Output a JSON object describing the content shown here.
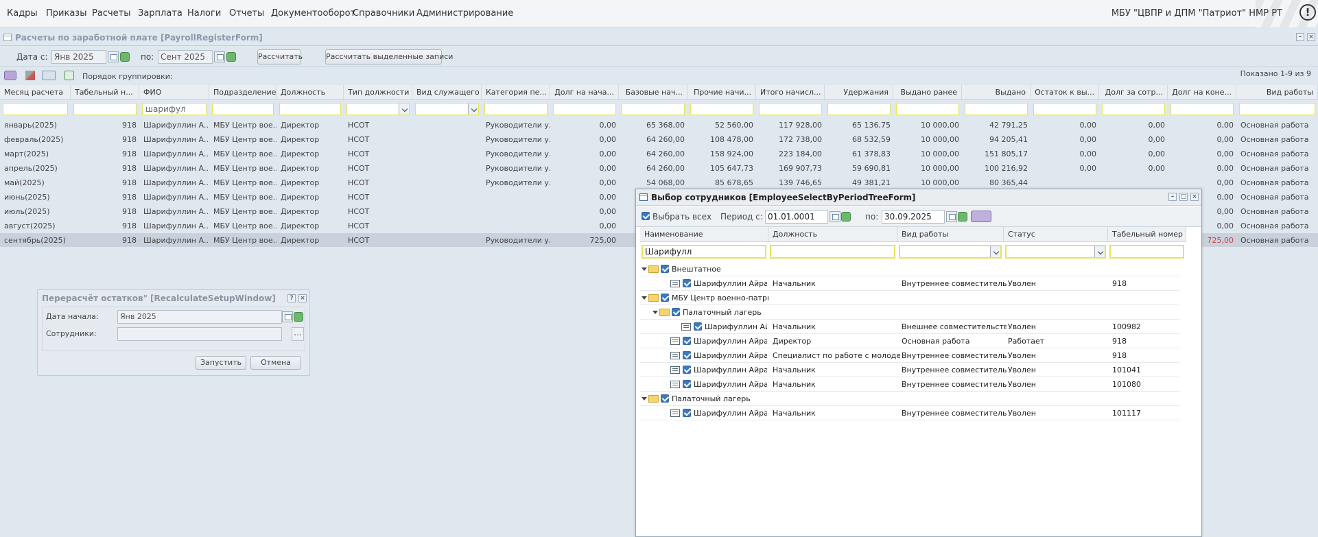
{
  "topbar": {
    "menu": [
      "Кадры",
      "Приказы",
      "Расчеты",
      "Зарплата",
      "Налоги",
      "Отчеты",
      "Документооборот",
      "Справочники",
      "Администрирование"
    ],
    "org": "МБУ \"ЦВПР и ДПМ \"Патриот\" НМР РТ",
    "info_glyph": "!"
  },
  "payroll": {
    "title": "Расчеты по заработной плате [PayrollRegisterForm]",
    "date_from_label": "Дата с:",
    "date_from": "Янв 2025",
    "date_to_label": "по:",
    "date_to": "Сент 2025",
    "calc_btn": "Рассчитать",
    "calc_sel_btn": "Рассчитать выделенные записи",
    "grouping_label": "Порядок группировки:",
    "shown": "Показано 1-9 из 9",
    "columns": [
      "Месяц расчета",
      "Табельный н...",
      "ФИО",
      "Подразделение",
      "Должность",
      "Тип должности",
      "Вид служащего",
      "Категория пе...",
      "Долг на нача...",
      "Базовые нач...",
      "Прочие начи...",
      "Итого начисл...",
      "Удержания",
      "Выдано ранее",
      "Выдано",
      "Остаток к вы...",
      "Долг за сотр...",
      "Долг на коне...",
      "Вид работы"
    ],
    "filter_fio": "шарифул",
    "rows": [
      [
        "январь(2025)",
        "918",
        "Шарифуллин А...",
        "МБУ Центр вое...",
        "Директор",
        "НСОТ",
        "",
        "Руководители у...",
        "0,00",
        "65 368,00",
        "52 560,00",
        "117 928,00",
        "65 136,75",
        "10 000,00",
        "42 791,25",
        "0,00",
        "0,00",
        "0,00",
        "Основная работа"
      ],
      [
        "февраль(2025)",
        "918",
        "Шарифуллин А...",
        "МБУ Центр вое...",
        "Директор",
        "НСОТ",
        "",
        "Руководители у...",
        "0,00",
        "64 260,00",
        "108 478,00",
        "172 738,00",
        "68 532,59",
        "10 000,00",
        "94 205,41",
        "0,00",
        "0,00",
        "0,00",
        "Основная работа"
      ],
      [
        "март(2025)",
        "918",
        "Шарифуллин А...",
        "МБУ Центр вое...",
        "Директор",
        "НСОТ",
        "",
        "Руководители у...",
        "0,00",
        "64 260,00",
        "158 924,00",
        "223 184,00",
        "61 378,83",
        "10 000,00",
        "151 805,17",
        "0,00",
        "0,00",
        "0,00",
        "Основная работа"
      ],
      [
        "апрель(2025)",
        "918",
        "Шарифуллин А...",
        "МБУ Центр вое...",
        "Директор",
        "НСОТ",
        "",
        "Руководители у...",
        "0,00",
        "64 260,00",
        "105 647,73",
        "169 907,73",
        "59 690,81",
        "10 000,00",
        "100 216,92",
        "0,00",
        "0,00",
        "0,00",
        "Основная работа"
      ],
      [
        "май(2025)",
        "918",
        "Шарифуллин А...",
        "МБУ Центр вое...",
        "Директор",
        "НСОТ",
        "",
        "Руководители у...",
        "0,00",
        "54 068,00",
        "85 678,65",
        "139 746,65",
        "49 381,21",
        "10 000,00",
        "80 365,44",
        "",
        "",
        "0,00",
        "Основная работа"
      ],
      [
        "июнь(2025)",
        "918",
        "Шарифуллин А...",
        "МБУ Центр вое...",
        "Директор",
        "НСОТ",
        "",
        "",
        "0,00",
        "",
        "",
        "",
        "",
        "",
        "",
        "",
        "",
        "0,00",
        "Основная работа"
      ],
      [
        "июль(2025)",
        "918",
        "Шарифуллин А...",
        "МБУ Центр вое...",
        "Директор",
        "НСОТ",
        "",
        "",
        "0,00",
        "",
        "",
        "",
        "",
        "",
        "",
        "",
        "",
        "0,00",
        "Основная работа"
      ],
      [
        "август(2025)",
        "918",
        "Шарифуллин А...",
        "МБУ Центр вое...",
        "Директор",
        "НСОТ",
        "",
        "",
        "0,00",
        "",
        "",
        "",
        "",
        "",
        "",
        "",
        "",
        "0,00",
        "Основная работа"
      ],
      [
        "сентябрь(2025)",
        "918",
        "Шарифуллин А...",
        "МБУ Центр вое...",
        "Директор",
        "НСОТ",
        "",
        "Руководители у...",
        "725,00",
        "",
        "",
        "",
        "",
        "",
        "",
        "",
        "",
        "725,00",
        "Основная работа"
      ]
    ]
  },
  "recalc": {
    "title": "Перерасчёт остатков\" [RecalculateSetupWindow]",
    "start_label": "Дата начала:",
    "start_value": "Янв 2025",
    "emp_label": "Сотрудники:",
    "emp_value": "",
    "ellipsis": "...",
    "run_btn": "Запустить",
    "cancel_btn": "Отмена"
  },
  "empselect": {
    "title": "Выбор сотрудников [EmployeeSelectByPeriodTreeForm]",
    "select_all": "Выбрать всех",
    "period_label": "Период с:",
    "period_from": "01.01.0001",
    "period_to_label": "по:",
    "period_to": "30.09.2025",
    "columns": [
      "Наименование",
      "Должность",
      "Вид работы",
      "Статус",
      "Табельный номер"
    ],
    "filter_name": "Шарифулл",
    "tree": [
      {
        "level": 0,
        "type": "folder",
        "name": "Внештатное"
      },
      {
        "level": 1,
        "type": "leaf",
        "name": "Шарифуллин Айрат Га...",
        "pos": "Начальник",
        "work": "Внутреннее совместительство",
        "status": "Уволен",
        "tab": "918"
      },
      {
        "level": 0,
        "type": "folder",
        "name": "МБУ Центр военно-патри..."
      },
      {
        "level": 1,
        "type": "folder",
        "name": "Палаточный лагерь"
      },
      {
        "level": 2,
        "type": "leaf",
        "name": "Шарифуллин Айрат...",
        "pos": "Начальник",
        "work": "Внешнее совместительство",
        "status": "Уволен",
        "tab": "100982"
      },
      {
        "level": 1,
        "type": "leaf",
        "name": "Шарифуллин Айрат Га...",
        "pos": "Директор",
        "work": "Основная работа",
        "status": "Работает",
        "tab": "918"
      },
      {
        "level": 1,
        "type": "leaf",
        "name": "Шарифуллин Айрат Га...",
        "pos": "Специалист по работе с молодежью",
        "work": "Внутреннее совместительство",
        "status": "Уволен",
        "tab": "918"
      },
      {
        "level": 1,
        "type": "leaf",
        "name": "Шарифуллин Айрат Га...",
        "pos": "Начальник",
        "work": "Внутреннее совместительство",
        "status": "Уволен",
        "tab": "101041"
      },
      {
        "level": 1,
        "type": "leaf",
        "name": "Шарифуллин Айрат Га...",
        "pos": "Начальник",
        "work": "Внутреннее совместительство",
        "status": "Уволен",
        "tab": "101080"
      },
      {
        "level": 0,
        "type": "folder",
        "name": "Палаточный лагерь"
      },
      {
        "level": 1,
        "type": "leaf",
        "name": "Шарифуллин Айрат Га...",
        "pos": "Начальник",
        "work": "Внутреннее совместительство",
        "status": "Уволен",
        "tab": "101117"
      }
    ]
  }
}
